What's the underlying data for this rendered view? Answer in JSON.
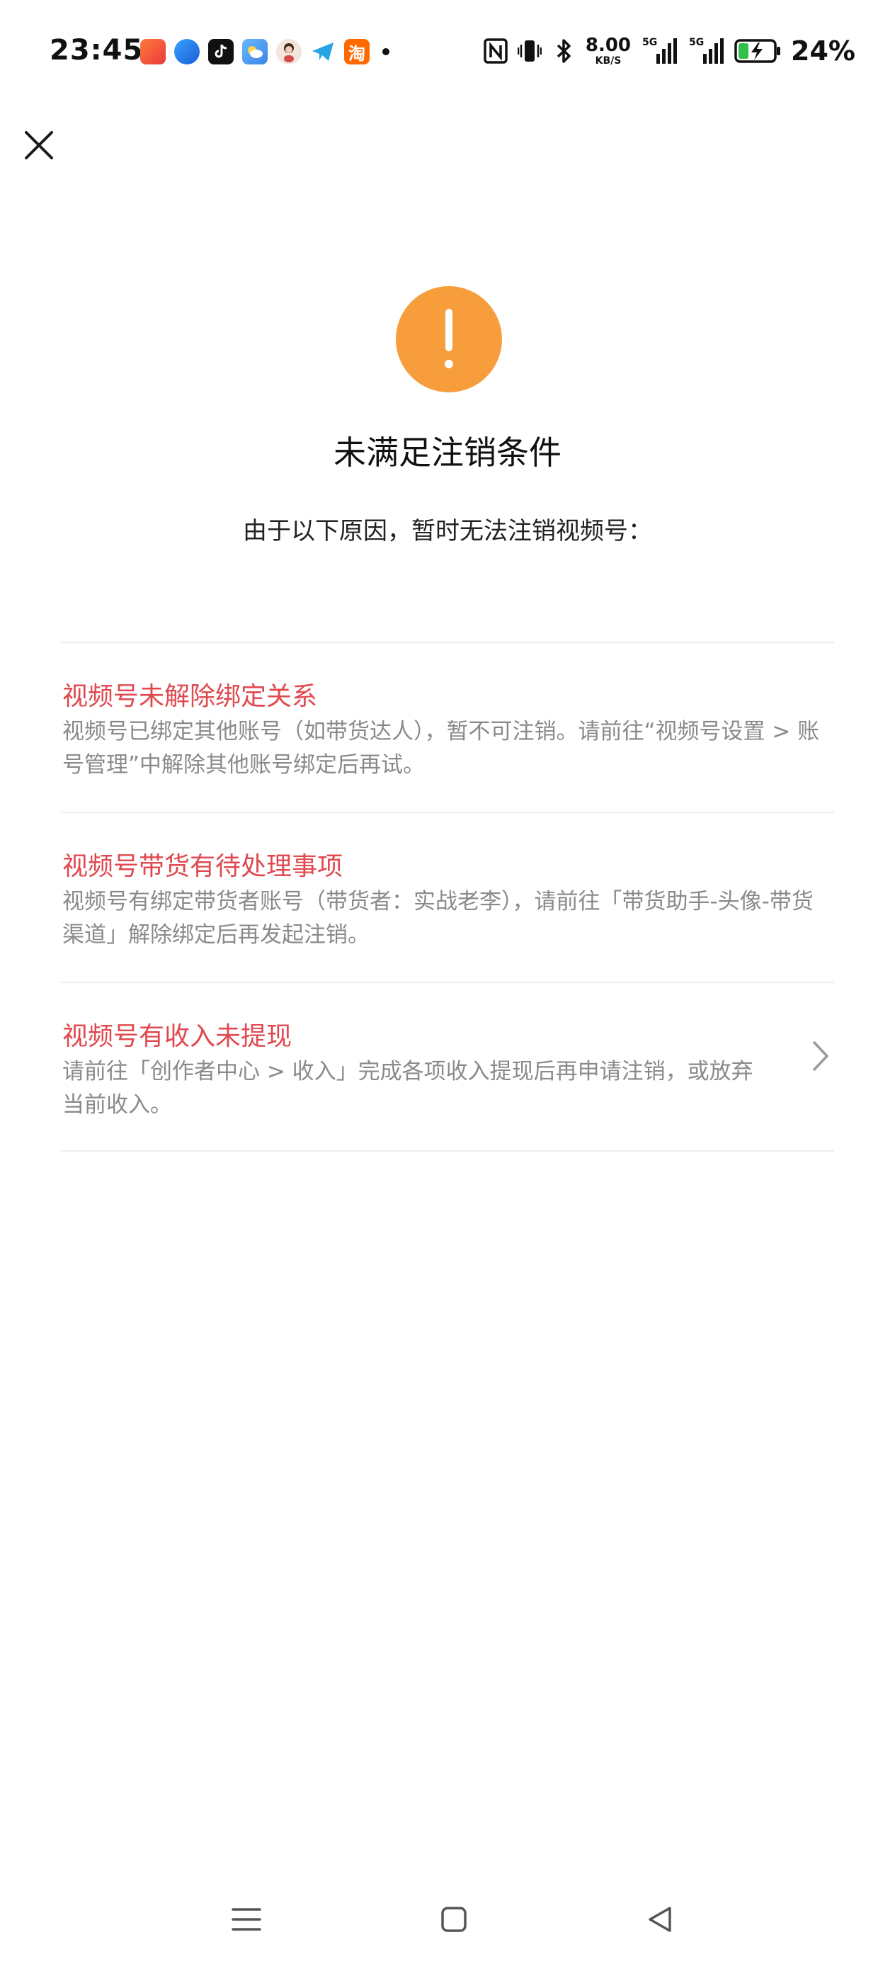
{
  "status_bar": {
    "time": "23:45",
    "network_speed_value": "8.00",
    "network_speed_unit": "KB/S",
    "signal_1_label": "5G",
    "signal_2_label": "5G",
    "battery_percent": "24%",
    "app_icons": [
      "photos-app-icon",
      "browser-app-icon",
      "tiktok-app-icon",
      "weather-app-icon",
      "avatar-app-icon",
      "telegram-app-icon",
      "taobao-app-icon"
    ],
    "taobao_glyph": "淘"
  },
  "header": {
    "close_icon": "close-icon"
  },
  "hero": {
    "icon": "warning-icon",
    "icon_color": "#f79d3c",
    "title": "未满足注销条件",
    "subtitle": "由于以下原因，暂时无法注销视频号："
  },
  "reasons": [
    {
      "title": "视频号未解除绑定关系",
      "description": "视频号已绑定其他账号（如带货达人），暂不可注销。请前往“视频号设置 > 账号管理”中解除其他账号绑定后再试。"
    },
    {
      "title": "视频号带货有待处理事项",
      "description": "视频号有绑定带货者账号（带货者：实战老李），请前往「带货助手-头像-带货渠道」解除绑定后再发起注销。"
    },
    {
      "title": "视频号有收入未提现",
      "description": "请前往「创作者中心 > 收入」完成各项收入提现后再申请注销，或放弃当前收入。"
    }
  ],
  "colors": {
    "reason_title": "#e0494f",
    "reason_desc": "#8a8a8a",
    "divider": "#ededed"
  },
  "nav_bar": {
    "icons": [
      "menu-icon",
      "home-icon",
      "back-icon"
    ]
  }
}
